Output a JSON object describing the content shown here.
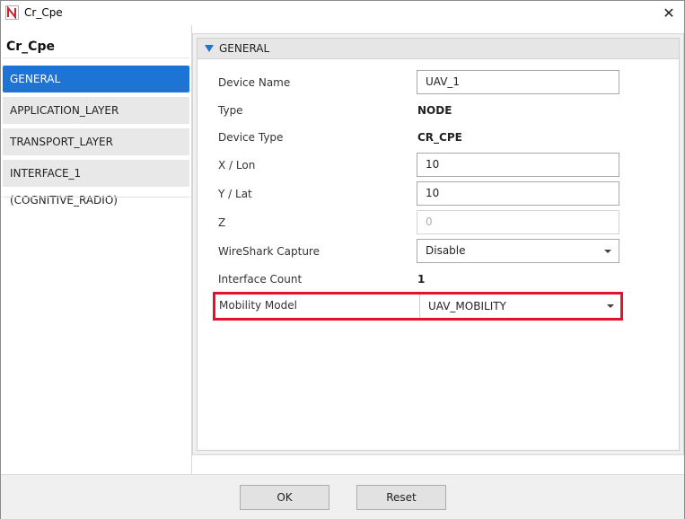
{
  "window": {
    "title": "Cr_Cpe",
    "icon": "netsim-logo-icon",
    "close_glyph": "✕"
  },
  "left": {
    "device_title": "Cr_Cpe",
    "items": [
      {
        "label": "GENERAL",
        "active": true
      },
      {
        "label": "APPLICATION_LAYER",
        "active": false
      },
      {
        "label": "TRANSPORT_LAYER",
        "active": false
      },
      {
        "label": "INTERFACE_1 (COGNITIVE_RADIO)",
        "active": false
      }
    ]
  },
  "section": {
    "title": "GENERAL"
  },
  "fields": {
    "device_name": {
      "label": "Device Name",
      "value": "UAV_1"
    },
    "type": {
      "label": "Type",
      "value": "NODE"
    },
    "device_type": {
      "label": "Device Type",
      "value": "CR_CPE"
    },
    "x_lon": {
      "label": "X / Lon",
      "value": "10"
    },
    "y_lat": {
      "label": "Y / Lat",
      "value": "10"
    },
    "z": {
      "label": "Z",
      "value": "0"
    },
    "wireshark": {
      "label": "WireShark Capture",
      "value": "Disable"
    },
    "interface_count": {
      "label": "Interface Count",
      "value": "1"
    },
    "mobility_model": {
      "label": "Mobility Model",
      "value": "UAV_MOBILITY"
    }
  },
  "footer": {
    "ok_label": "OK",
    "reset_label": "Reset"
  },
  "colors": {
    "accent": "#1e74d4",
    "highlight": "#e0142e"
  }
}
